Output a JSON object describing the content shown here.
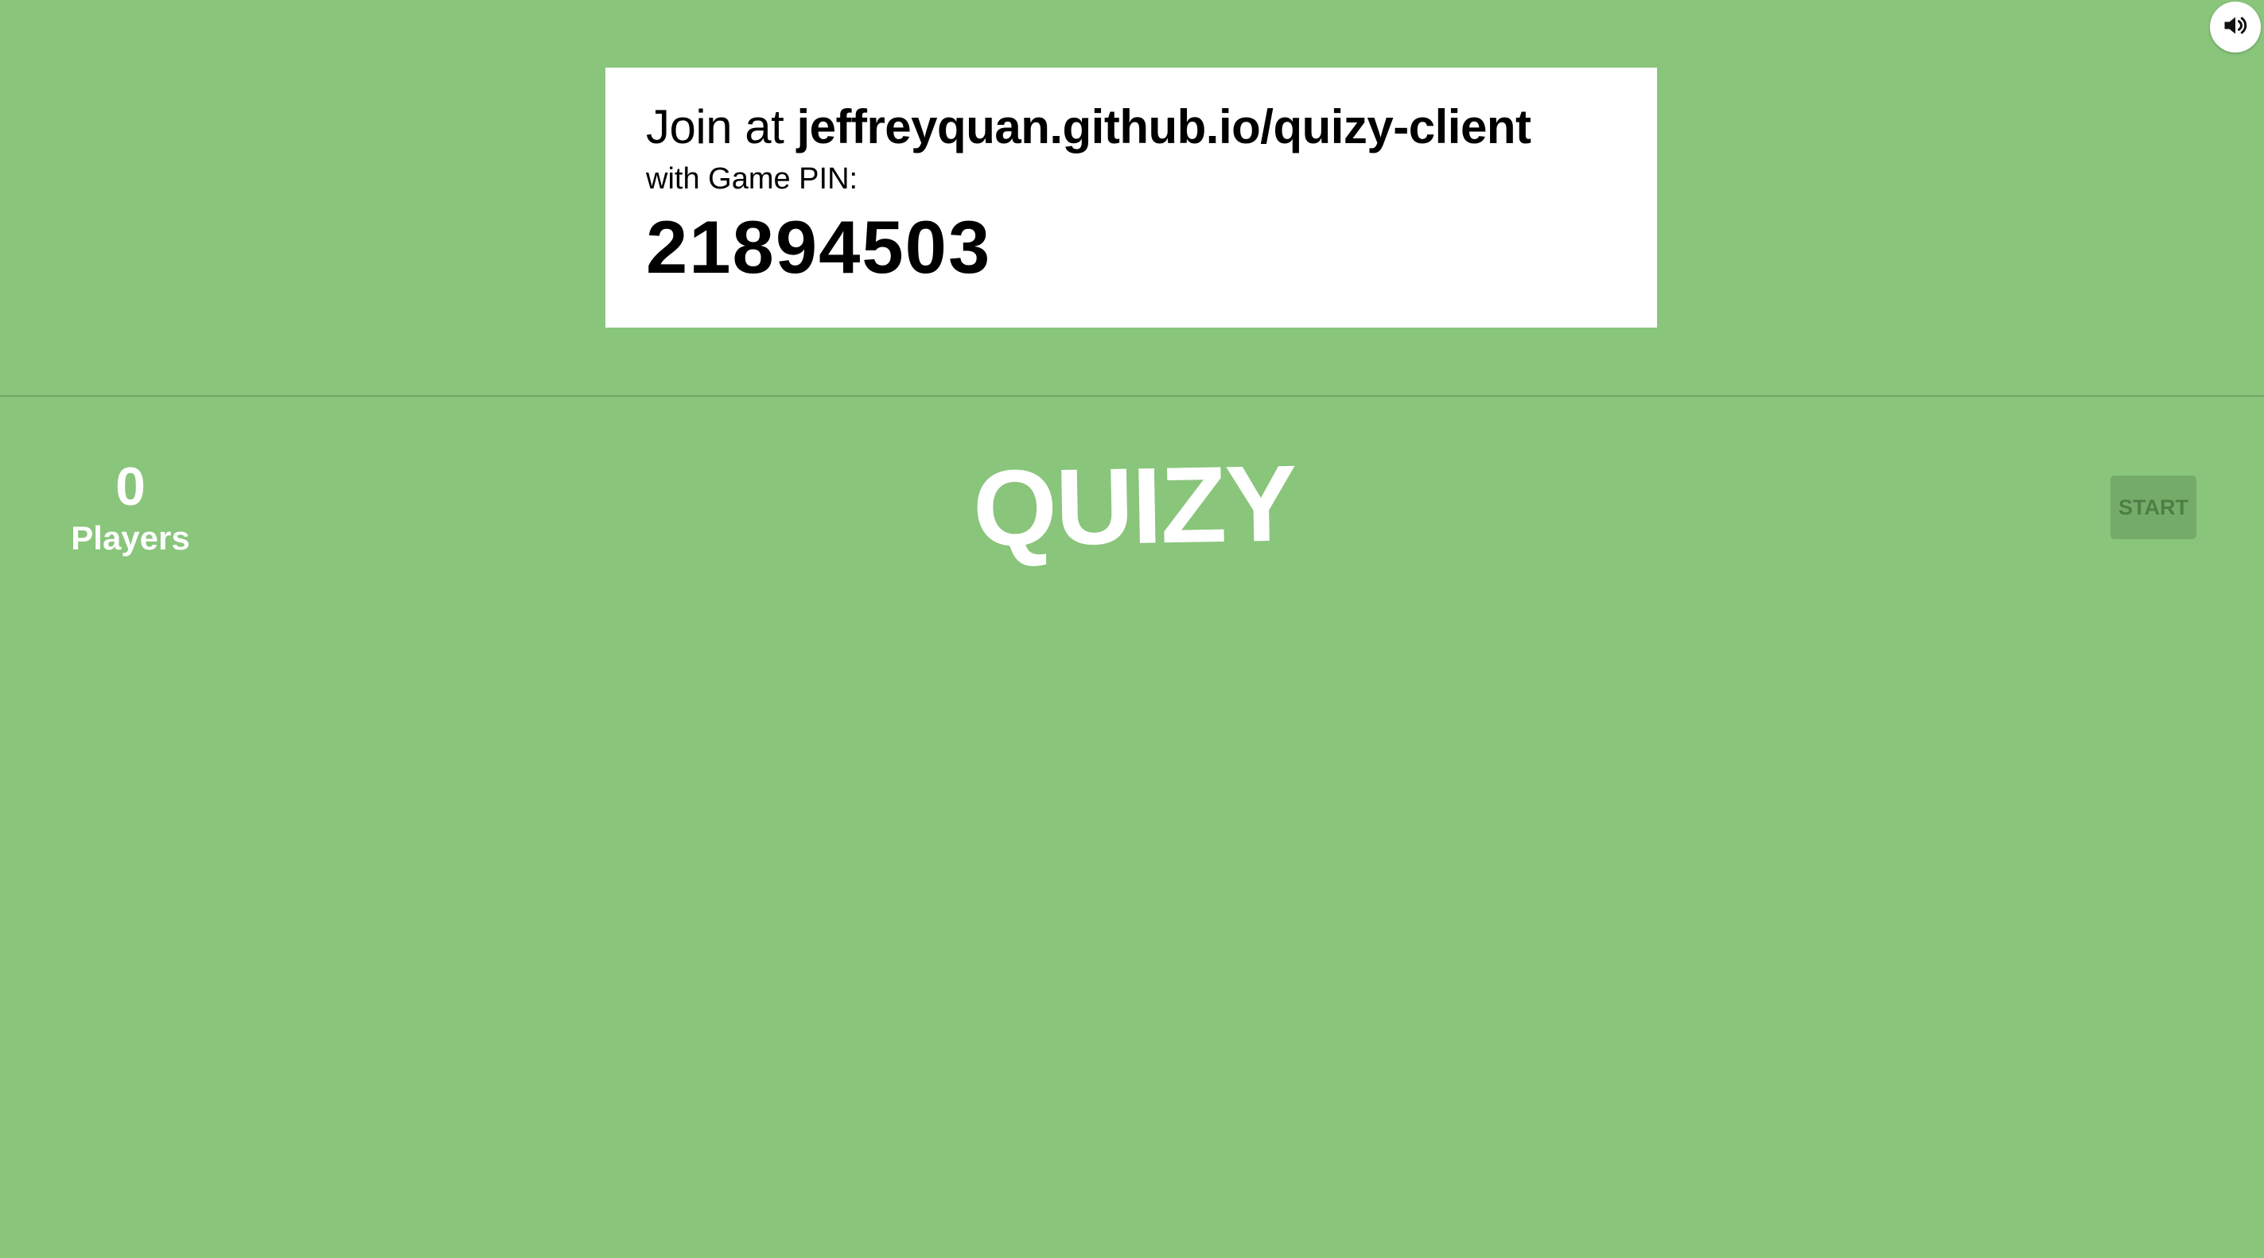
{
  "sound": {
    "icon": "speaker-volume-icon"
  },
  "join_card": {
    "prefix": "Join at",
    "url": "jeffreyquan.github.io/quizy-client",
    "pin_label": "with Game PIN:",
    "pin": "21894503"
  },
  "players": {
    "count": "0",
    "label": "Players"
  },
  "title": "QUIZY",
  "start_button": {
    "label": "START",
    "enabled": false
  },
  "colors": {
    "background": "#89c57b",
    "card": "#ffffff",
    "start_button_bg": "#75ab69",
    "start_button_text": "#4e7d45"
  }
}
